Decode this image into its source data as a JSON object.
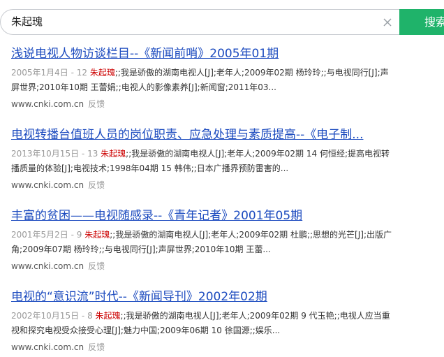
{
  "search": {
    "query": "朱起瑰",
    "button_label": "搜索"
  },
  "results": [
    {
      "title": "浅说电视人物访谈栏目--《新闻前哨》2005年01期",
      "date": "2005年1月4日",
      "sep": " - ",
      "num": "12 ",
      "keyword": "朱起瑰",
      "snippet": ";;我是骄傲的湖南电视人[J];老年人;2009年02期 杨玲玲;;与电视同行[J];声屏世界;2010年10期 王蕾娟;;电视人的影像素养[J];新闻窗;2011年03...",
      "source": "www.cnki.com.cn",
      "feedback": "反馈"
    },
    {
      "title": "电视转播台值班人员的岗位职责、应急处理与素质提高--《电子制...",
      "date": "2013年10月15日",
      "sep": " - ",
      "num": "13 ",
      "keyword": "朱起瑰",
      "snippet": ";;我是骄傲的湖南电视人[J];老年人;2009年02期 14 何恒经;提高电视转播质量的体验[J];电视技术;1998年04期 15 韩伟;;日本广播界预防雷害的...",
      "source": "www.cnki.com.cn",
      "feedback": "反馈"
    },
    {
      "title": "丰富的贫困——电视随感录--《青年记者》2001年05期",
      "date": "2001年5月2日",
      "sep": " - ",
      "num": "9 ",
      "keyword": "朱起瑰",
      "snippet": ";;我是骄傲的湖南电视人[J];老年人;2009年02期 杜鹏;;思想的光芒[J];出版广角;2009年07期 杨玲玲;;与电视同行[J];声屏世界;2010年10期 王蕾...",
      "source": "www.cnki.com.cn",
      "feedback": "反馈"
    },
    {
      "title": "电视的“意识流”时代--《新闻导刊》2002年02期",
      "date": "2002年10月15日",
      "sep": " - ",
      "num": "8 ",
      "keyword": "朱起瑰",
      "snippet": ";;我是骄傲的湖南电视人[J];老年人;2009年02期 9 代玉艳;;电视人应当重视和探究电视受众接受心理[J];魅力中国;2009年06期 10 徐国源;;娱乐...",
      "source": "www.cnki.com.cn",
      "feedback": "反馈"
    }
  ]
}
